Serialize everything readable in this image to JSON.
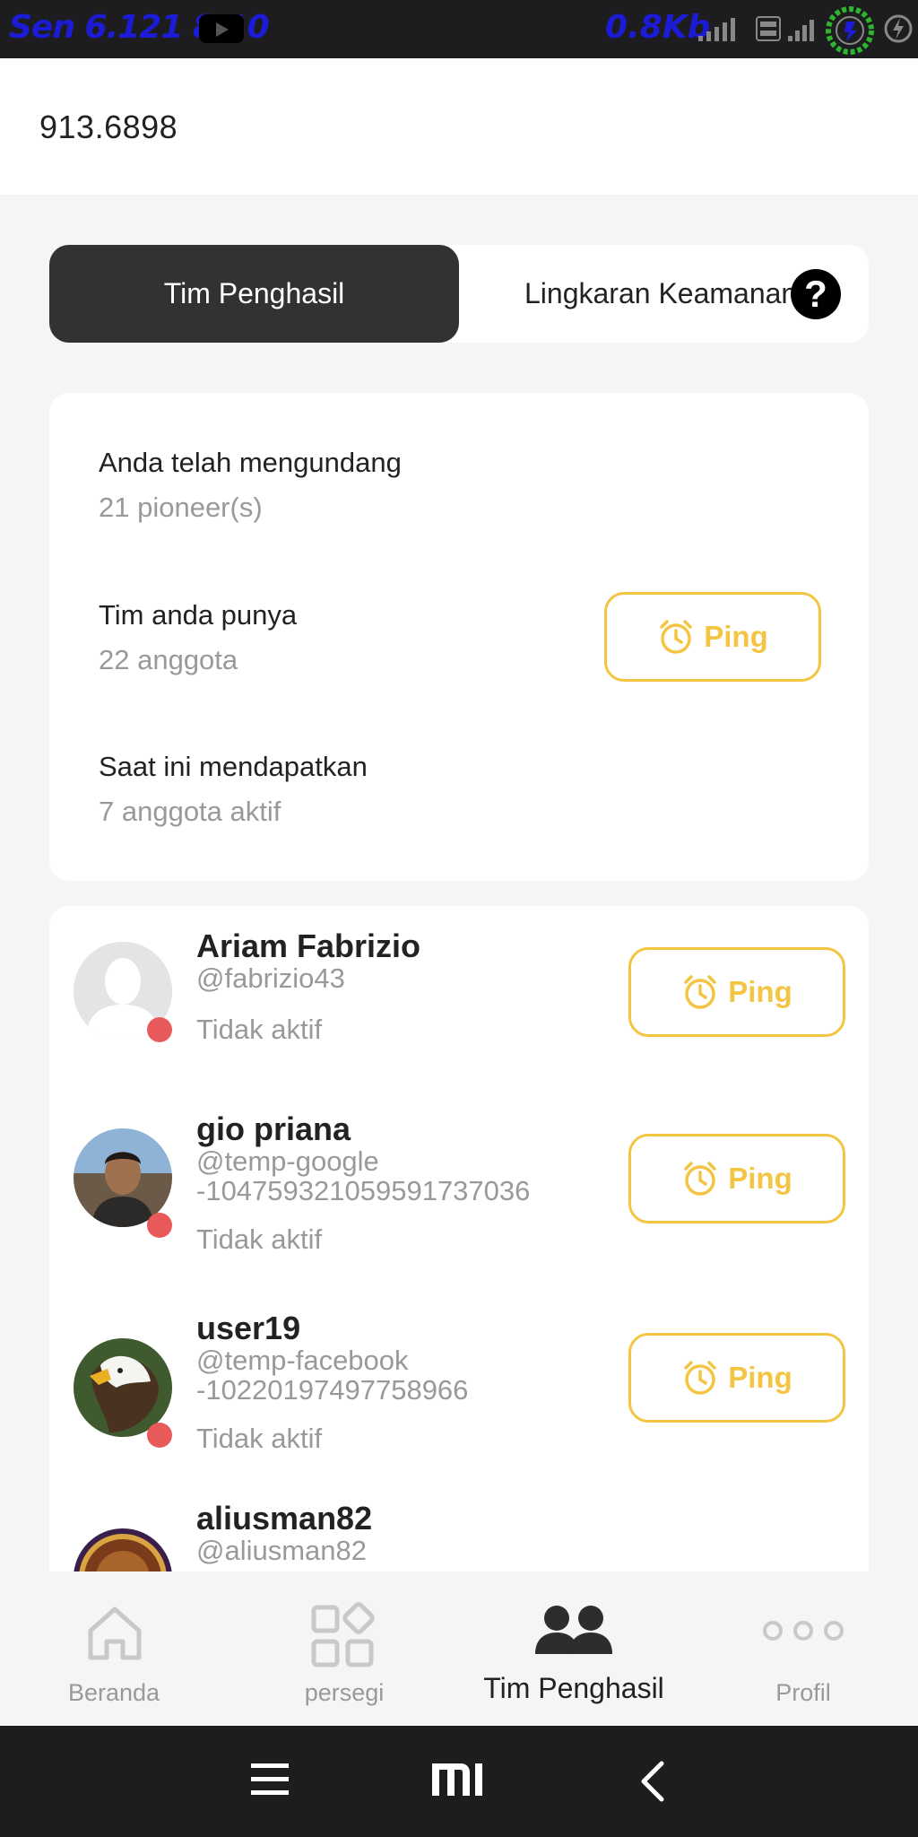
{
  "status_bar": {
    "time": "Sen 6.121 8.10",
    "speed": "0.8Kb"
  },
  "header": {
    "balance": "913.6898"
  },
  "tabs": {
    "active": "Tim Penghasil",
    "inactive": "Lingkaran Keamanan",
    "help": "?"
  },
  "stats": {
    "invited_label": "Anda telah mengundang",
    "invited_value": "21 pioneer(s)",
    "team_label": "Tim anda punya",
    "team_value": "22 anggota",
    "active_label": "Saat ini mendapatkan",
    "active_value": "7 anggota aktif",
    "ping_label": "Ping"
  },
  "members": [
    {
      "name": "Ariam Fabrizio",
      "handle": "@fabrizio43",
      "status": "Tidak aktif",
      "ping": "Ping"
    },
    {
      "name": "gio priana",
      "handle": "@temp-google\n-104759321059591737036",
      "status": "Tidak aktif",
      "ping": "Ping"
    },
    {
      "name": "user19",
      "handle": "@temp-facebook\n-10220197497758966",
      "status": "Tidak aktif",
      "ping": "Ping"
    },
    {
      "name": "aliusman82",
      "handle": "@aliusman82"
    }
  ],
  "nav": {
    "home": "Beranda",
    "square": "persegi",
    "team": "Tim Penghasil",
    "profile": "Profil"
  },
  "colors": {
    "accent": "#f4c542",
    "dark": "#323232",
    "inactive_dot": "#e85a5a",
    "muted": "#999999"
  }
}
